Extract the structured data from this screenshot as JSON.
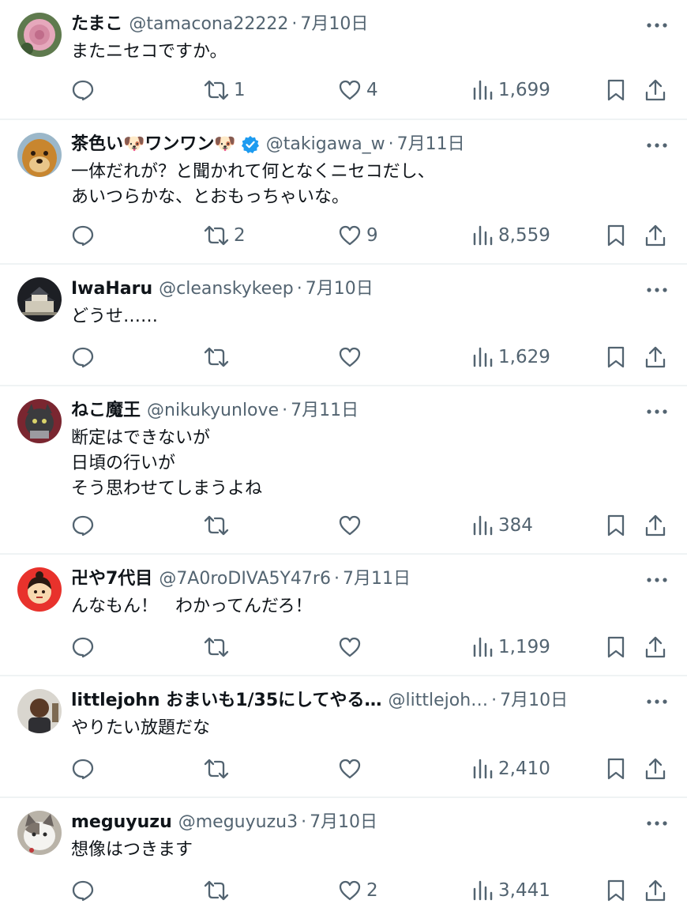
{
  "tweets": [
    {
      "name": "たまこ",
      "handle": "@tamacona22222",
      "date": "7月10日",
      "text": "またニセコですか。",
      "reply_count": "",
      "retweet_count": "1",
      "like_count": "4",
      "view_count": "1,699"
    },
    {
      "name": "茶色い🐶ワンワン🐶",
      "handle": "@takigawa_w",
      "date": "7月11日",
      "text": "一体だれが？と聞かれて何となくニセコだし、\nあいつらかな、とおもっちゃいな。",
      "reply_count": "",
      "retweet_count": "2",
      "like_count": "9",
      "view_count": "8,559"
    },
    {
      "name": "IwaHaru",
      "handle": "@cleanskykeep",
      "date": "7月10日",
      "text": "どうせ……",
      "reply_count": "",
      "retweet_count": "",
      "like_count": "",
      "view_count": "1,629"
    },
    {
      "name": "ねこ魔王",
      "handle": "@nikukyunlove",
      "date": "7月11日",
      "text": "断定はできないが\n日頃の行いが\nそう思わせてしまうよね",
      "reply_count": "",
      "retweet_count": "",
      "like_count": "",
      "view_count": "384"
    },
    {
      "name": "卍や7代目",
      "handle": "@7A0roDIVA5Y47r6",
      "date": "7月11日",
      "text": "んなもん！　わかってんだろ！",
      "reply_count": "",
      "retweet_count": "",
      "like_count": "",
      "view_count": "1,199"
    },
    {
      "name": "littlejohn おまいも1/35にしてやる…",
      "handle": "@littlejoh…",
      "date": "7月10日",
      "text": "やりたい放題だな",
      "reply_count": "",
      "retweet_count": "",
      "like_count": "",
      "view_count": "2,410"
    },
    {
      "name": "meguyuzu",
      "handle": "@meguyuzu3",
      "date": "7月10日",
      "text": "想像はつきます",
      "reply_count": "",
      "retweet_count": "",
      "like_count": "2",
      "view_count": "3,441"
    }
  ],
  "separator": "·",
  "colors": {
    "text": "#0f1419",
    "secondary": "#536471",
    "verified": "#1d9bf0",
    "divider": "#eff3f4"
  },
  "icons": {
    "reply": "reply-icon",
    "retweet": "retweet-icon",
    "like": "like-icon",
    "views": "views-icon",
    "bookmark": "bookmark-icon",
    "share": "share-icon",
    "more": "more-icon",
    "verified": "verified-badge-icon"
  }
}
